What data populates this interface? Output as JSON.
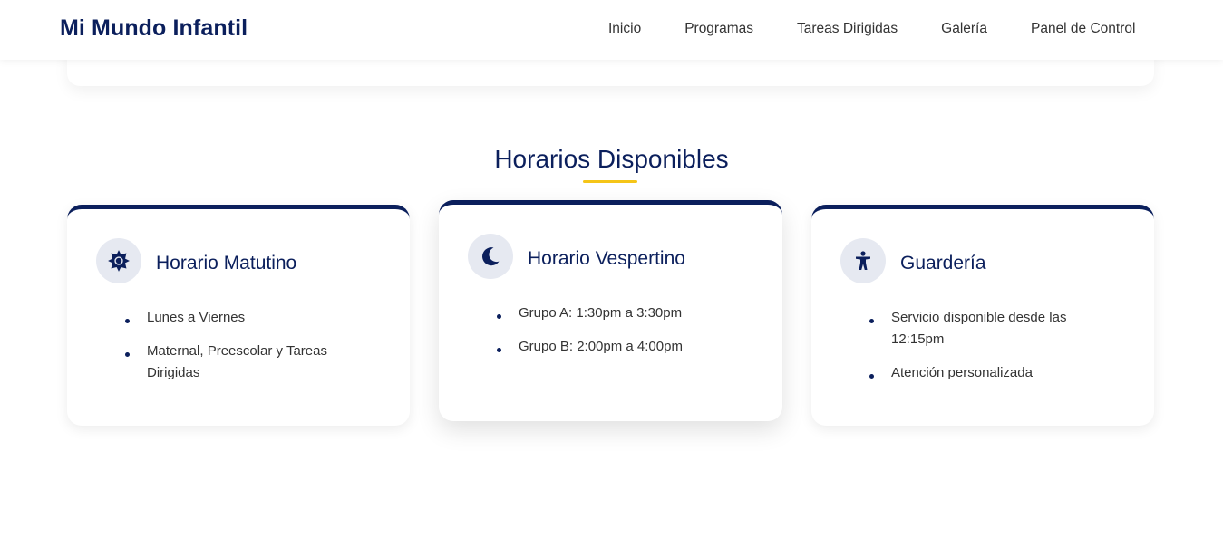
{
  "header": {
    "brand": "Mi Mundo Infantil",
    "nav": [
      "Inicio",
      "Programas",
      "Tareas Dirigidas",
      "Galería",
      "Panel de Control"
    ]
  },
  "schedules": {
    "title": "Horarios Disponibles",
    "cards": [
      {
        "icon": "sun-icon",
        "title": "Horario Matutino",
        "items": [
          "Lunes a Viernes",
          "Maternal, Preescolar y Tareas Dirigidas"
        ]
      },
      {
        "icon": "moon-icon",
        "title": "Horario Vespertino",
        "items": [
          "Grupo A: 1:30pm a 3:30pm",
          "Grupo B: 2:00pm a 4:00pm"
        ]
      },
      {
        "icon": "child-icon",
        "title": "Guardería",
        "items": [
          "Servicio disponible desde las 12:15pm",
          "Atención personalizada"
        ]
      }
    ]
  },
  "colors": {
    "primary": "#0b1f5c",
    "accent": "#f5c518",
    "icon_bg": "#e6e9f1"
  }
}
